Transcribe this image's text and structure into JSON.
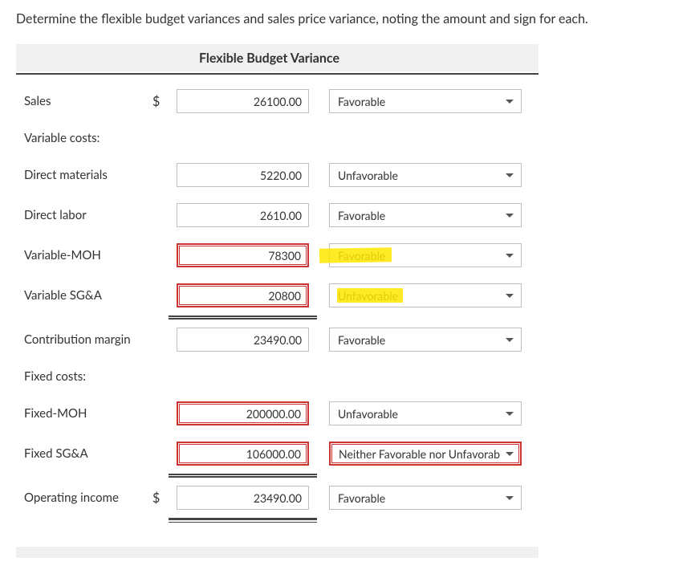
{
  "question": "Determine the flexible budget variances and sales price variance, noting the amount and sign for each.",
  "header": "Flexible Budget Variance",
  "labels": {
    "sales": "Sales",
    "variable_costs": "Variable costs:",
    "direct_materials": "Direct materials",
    "direct_labor": "Direct labor",
    "variable_moh": "Variable-MOH",
    "variable_sga": "Variable SG&A",
    "contribution_margin": "Contribution margin",
    "fixed_costs": "Fixed costs:",
    "fixed_moh": "Fixed-MOH",
    "fixed_sga": "Fixed SG&A",
    "operating_income": "Operating income"
  },
  "currency": "$",
  "values": {
    "sales": "26100.00",
    "direct_materials": "5220.00",
    "direct_labor": "2610.00",
    "variable_moh": "78300",
    "variable_sga": "20800",
    "contribution_margin": "23490.00",
    "fixed_moh": "200000.00",
    "fixed_sga": "106000.00",
    "operating_income": "23490.00"
  },
  "signs": {
    "sales": "Favorable",
    "direct_materials": "Unfavorable",
    "direct_labor": "Favorable",
    "variable_moh": "Favorable",
    "variable_sga": "Unfavorable",
    "contribution_margin": "Favorable",
    "fixed_moh": "Unfavorable",
    "fixed_sga": "Neither Favorable nor Unfavorable",
    "operating_income": "Favorable"
  },
  "sign_options": [
    "Favorable",
    "Unfavorable",
    "Neither Favorable nor Unfavorable"
  ],
  "row_status": {
    "sales": {
      "amount_wrong": false,
      "sign_wrong": false,
      "highlight": null
    },
    "direct_materials": {
      "amount_wrong": false,
      "sign_wrong": false,
      "highlight": null
    },
    "direct_labor": {
      "amount_wrong": false,
      "sign_wrong": false,
      "highlight": null
    },
    "variable_moh": {
      "amount_wrong": true,
      "sign_wrong": false,
      "highlight": "favorable"
    },
    "variable_sga": {
      "amount_wrong": true,
      "sign_wrong": false,
      "highlight": "unfavorable"
    },
    "contribution_margin": {
      "amount_wrong": false,
      "sign_wrong": false,
      "highlight": null
    },
    "fixed_moh": {
      "amount_wrong": true,
      "sign_wrong": false,
      "highlight": null
    },
    "fixed_sga": {
      "amount_wrong": true,
      "sign_wrong": true,
      "highlight": null
    },
    "operating_income": {
      "amount_wrong": false,
      "sign_wrong": false,
      "highlight": null
    }
  }
}
